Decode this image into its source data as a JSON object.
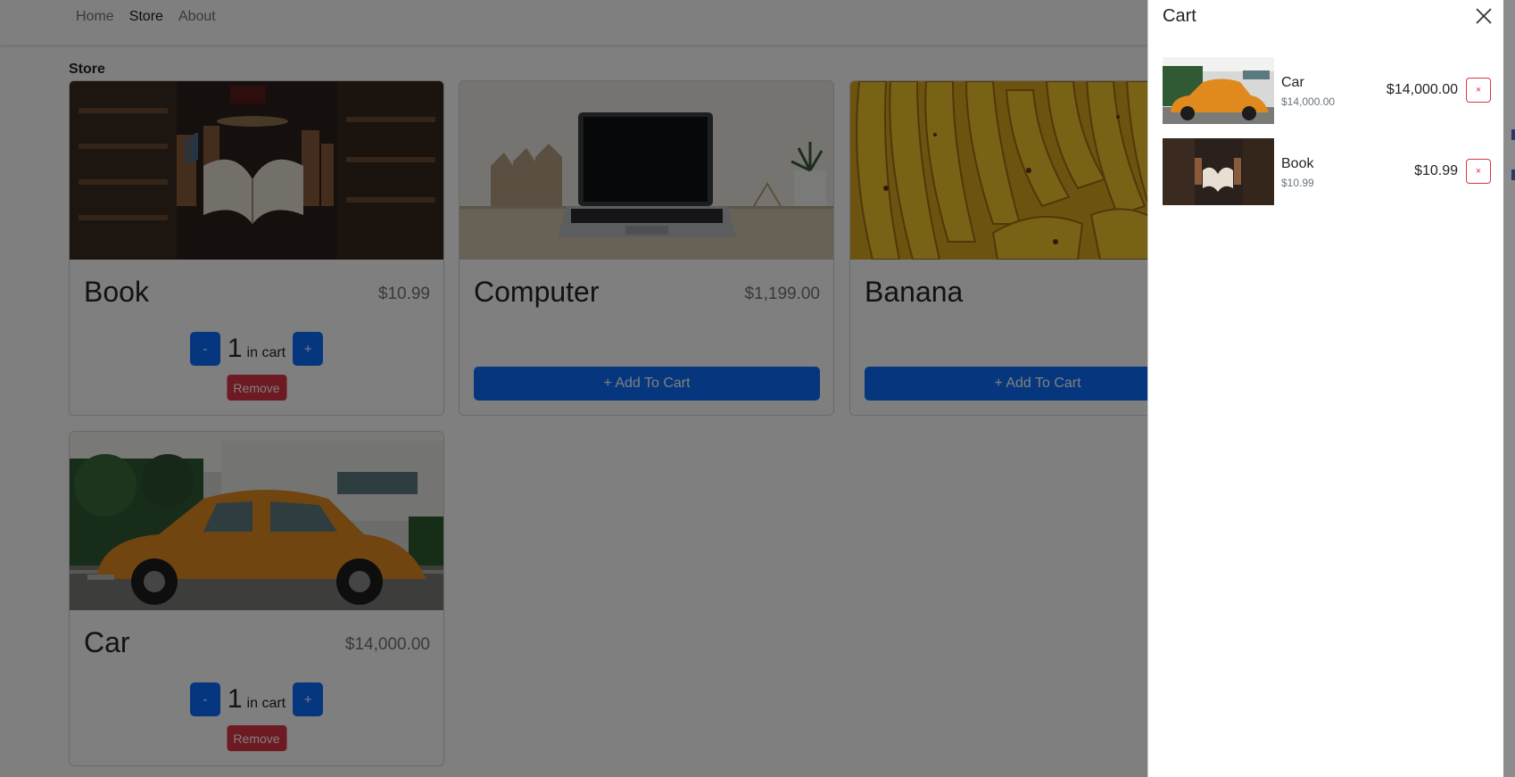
{
  "nav": {
    "links": [
      {
        "label": "Home",
        "active": false
      },
      {
        "label": "Store",
        "active": true
      },
      {
        "label": "About",
        "active": false
      }
    ]
  },
  "page": {
    "heading": "Store"
  },
  "products": {
    "book": {
      "name": "Book",
      "price": "$10.99",
      "quantity": "1",
      "in_cart_label": "in cart",
      "minus": "-",
      "plus": "+",
      "remove": "Remove",
      "image_icon": "book-photo"
    },
    "computer": {
      "name": "Computer",
      "price": "$1,199.00",
      "add_label": "+ Add To Cart",
      "image_icon": "laptop-photo"
    },
    "banana": {
      "name": "Banana",
      "add_label": "+ Add To Cart",
      "image_icon": "banana-photo"
    },
    "car": {
      "name": "Car",
      "price": "$14,000.00",
      "quantity": "1",
      "in_cart_label": "in cart",
      "minus": "-",
      "plus": "+",
      "remove": "Remove",
      "image_icon": "car-photo"
    }
  },
  "cart": {
    "title": "Cart",
    "close_icon": "close-icon",
    "items": [
      {
        "name": "Car",
        "unit_price": "$14,000.00",
        "line_total": "$14,000.00",
        "remove": "×"
      },
      {
        "name": "Book",
        "unit_price": "$10.99",
        "line_total": "$10.99",
        "remove": "×"
      }
    ]
  },
  "colors": {
    "primary": "#0d6efd",
    "danger": "#dc3545",
    "muted": "#6c757d",
    "backdrop": "rgba(0,0,0,0.5)"
  }
}
